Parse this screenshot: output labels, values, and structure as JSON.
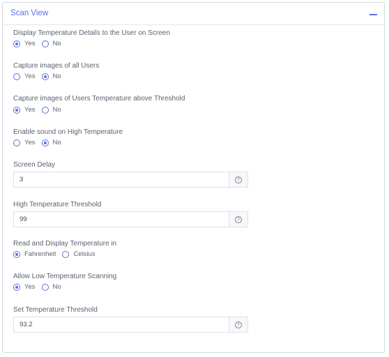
{
  "panel": {
    "title": "Scan View",
    "collapse_icon": "minus-icon"
  },
  "settings": {
    "display_temp": {
      "label": "Display Temperature Details to the User on Screen",
      "options": [
        "Yes",
        "No"
      ],
      "selected": "Yes"
    },
    "capture_all": {
      "label": "Capture images of all Users",
      "options": [
        "Yes",
        "No"
      ],
      "selected": "No"
    },
    "capture_above": {
      "label": "Capture images of Users Temperature above Threshold",
      "options": [
        "Yes",
        "No"
      ],
      "selected": "Yes"
    },
    "sound_high": {
      "label": "Enable sound on High Temperature",
      "options": [
        "Yes",
        "No"
      ],
      "selected": "No"
    },
    "screen_delay": {
      "label": "Screen Delay",
      "value": "3",
      "help_icon": "question-circle-icon"
    },
    "high_threshold": {
      "label": "High Temperature Threshold",
      "value": "99",
      "help_icon": "question-circle-icon"
    },
    "temp_unit": {
      "label": "Read and Display Temperature in",
      "options": [
        "Fahrenheit",
        "Celsius"
      ],
      "selected": "Fahrenheit"
    },
    "low_scan": {
      "label": "Allow Low Temperature Scanning",
      "options": [
        "Yes",
        "No"
      ],
      "selected": "Yes"
    },
    "set_threshold": {
      "label": "Set Temperature Threshold",
      "value": "93.2",
      "help_icon": "question-circle-icon"
    }
  },
  "colors": {
    "accent": "#5a6fe0",
    "border": "#d6d9e0",
    "text": "#5c6170"
  }
}
